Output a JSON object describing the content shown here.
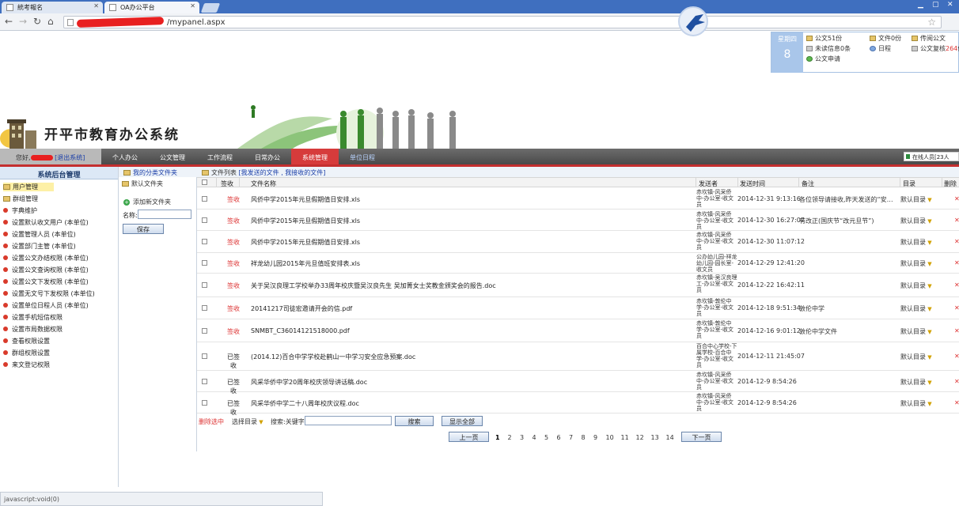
{
  "browser": {
    "tabs": [
      {
        "title": "統考報名",
        "active": false
      },
      {
        "title": "OA办公平台",
        "active": true
      }
    ],
    "url": "/mypanel.aspx",
    "status_text": "javascript:void(0)"
  },
  "header": {
    "site_title": "开平市教育办公系统",
    "weekday": "星期四",
    "day": "8",
    "info_items": [
      {
        "icon": "folder-icon",
        "text": "公文51份"
      },
      {
        "icon": "folder-icon",
        "text": "文件0份"
      },
      {
        "icon": "folder-icon",
        "text": "传阅公文"
      },
      {
        "icon": "folder-icon",
        "text": "未读信息0条"
      },
      {
        "icon": "calendar-icon",
        "text": "日程"
      },
      {
        "icon": "folder-icon",
        "text_prefix": "公文复核",
        "text_count": "264",
        "text_suffix": "份"
      },
      {
        "icon": "document-icon",
        "text": "公文申请"
      }
    ]
  },
  "nav": {
    "user_prefix": "您好,",
    "logout": "[退出系统]",
    "items": [
      "个人办公",
      "公文管理",
      "工作流程",
      "日常办公",
      "系统管理",
      "单位日程"
    ],
    "active_index": 4,
    "online": "在线人员[23人"
  },
  "sidebar": {
    "title": "系统后台管理",
    "items": [
      {
        "label": "用户管理",
        "icon": "folder-icon",
        "selected": true
      },
      {
        "label": "群组管理",
        "icon": "folder-icon",
        "selected": false
      },
      {
        "label": "字典维护",
        "icon": "bullet-icon",
        "selected": false
      },
      {
        "label": "设置默认收文用户 (本单位)",
        "icon": "bullet-icon",
        "selected": false
      },
      {
        "label": "设置管理人员 (本单位)",
        "icon": "bullet-icon",
        "selected": false
      },
      {
        "label": "设置部门主管 (本单位)",
        "icon": "bullet-icon",
        "selected": false
      },
      {
        "label": "设置公文办结权限 (本单位)",
        "icon": "bullet-icon",
        "selected": false
      },
      {
        "label": "设置公文查询权限 (本单位)",
        "icon": "bullet-icon",
        "selected": false
      },
      {
        "label": "设置公文下发权限 (本单位)",
        "icon": "bullet-icon",
        "selected": false
      },
      {
        "label": "设置无文号下发权限 (本单位)",
        "icon": "bullet-icon",
        "selected": false
      },
      {
        "label": "设置单位日程人员 (本单位)",
        "icon": "bullet-icon",
        "selected": false
      },
      {
        "label": "设置手机短信权限",
        "icon": "bullet-icon",
        "selected": false
      },
      {
        "label": "设置市局数据权限",
        "icon": "bullet-icon",
        "selected": false
      },
      {
        "label": "查看权限设置",
        "icon": "bullet-icon",
        "selected": false
      },
      {
        "label": "群组权限设置",
        "icon": "bullet-icon",
        "selected": false
      },
      {
        "label": "来文登记权限",
        "icon": "bullet-icon",
        "selected": false
      }
    ]
  },
  "folders": {
    "title": "我的分类文件夹",
    "default_folder": "默认文件夹",
    "add_label": "添加新文件夹",
    "name_label": "名称:",
    "save_label": "保存"
  },
  "filelist": {
    "title": "文件列表",
    "links": "[我发送的文件 , 我接收的文件]",
    "columns": [
      "签收",
      "文件名称",
      "发送者",
      "发送时间",
      "备注",
      "目录",
      "删除"
    ],
    "rows": [
      {
        "status": "签收",
        "pending": true,
        "name": "风侨中学2015年元旦假期值日安排.xls",
        "sender": "赤坎镇-风采侨中-办公室-收文员",
        "time": "2014-12-31 9:13:16",
        "remark": "各位领导请接收,昨天发送的“安…",
        "dir": "默认目录"
      },
      {
        "status": "签收",
        "pending": true,
        "name": "风侨中学2015年元旦假期值日安排.xls",
        "sender": "赤坎镇-风采侨中-办公室-收文员",
        "time": "2014-12-30 16:27:07",
        "remark": "有改正(国庆节“改元旦节”)",
        "dir": "默认目录"
      },
      {
        "status": "签收",
        "pending": true,
        "name": "风侨中学2015年元旦假期值日安排.xls",
        "sender": "赤坎镇-风采侨中-办公室-收文员",
        "time": "2014-12-30 11:07:12",
        "remark": "",
        "dir": "默认目录"
      },
      {
        "status": "签收",
        "pending": true,
        "name": "祥龙幼儿园2015年元旦值班安排表.xls",
        "sender": "公办幼儿园-祥龙幼儿园-园长室-收文员",
        "time": "2014-12-29 12:41:20",
        "remark": "",
        "dir": "默认目录"
      },
      {
        "status": "签收",
        "pending": true,
        "name": "关于吴汉良理工学校举办33周年校庆暨吴汉良先生 吴加箐女士奖教金颁奖会的报告.doc",
        "sender": "赤坎镇-吴汉良理工-办公室-收文员",
        "time": "2014-12-22 16:42:11",
        "remark": "",
        "dir": "默认目录"
      },
      {
        "status": "签收",
        "pending": true,
        "name": "20141217司徒宏邀请开会的信.pdf",
        "sender": "赤坎镇-敦伦中学-办公室-收文员",
        "time": "2014-12-18 9:51:34",
        "remark": "敦伦中学",
        "dir": "默认目录"
      },
      {
        "status": "签收",
        "pending": true,
        "name": "SNMBT_C36014121518000.pdf",
        "sender": "赤坎镇-敦伦中学-办公室-收文员",
        "time": "2014-12-16 9:01:12",
        "remark": "敦伦中学文件",
        "dir": "默认目录"
      },
      {
        "status": "已签收",
        "pending": false,
        "name": "(2014.12)百合中学学校赴鹤山一中学习安全应急预案.doc",
        "sender": "百合中心学校-下属学校-百合中学-办公室-收文员",
        "time": "2014-12-11 21:45:07",
        "remark": "",
        "dir": "默认目录"
      },
      {
        "status": "已签收",
        "pending": false,
        "name": "风采华侨中学20周年校庆领导讲话稿.doc",
        "sender": "赤坎镇-风采侨中-办公室-收文员",
        "time": "2014-12-9 8:54:26",
        "remark": "",
        "dir": "默认目录"
      },
      {
        "status": "已签收",
        "pending": false,
        "name": "风采华侨中学二十八周年校庆议程.doc",
        "sender": "赤坎镇-风采侨中-办公室-收文员",
        "time": "2014-12-9 8:54:26",
        "remark": "",
        "dir": "默认目录"
      }
    ],
    "delete_selected": "删除选中",
    "select_dir": "选择目录",
    "search_label": "搜索:关键字",
    "search_button": "搜索",
    "show_all_button": "显示全部",
    "prev": "上一页",
    "next": "下一页",
    "pages": [
      "1",
      "2",
      "3",
      "4",
      "5",
      "6",
      "7",
      "8",
      "9",
      "10",
      "11",
      "12",
      "13",
      "14"
    ],
    "current_page": "1"
  }
}
